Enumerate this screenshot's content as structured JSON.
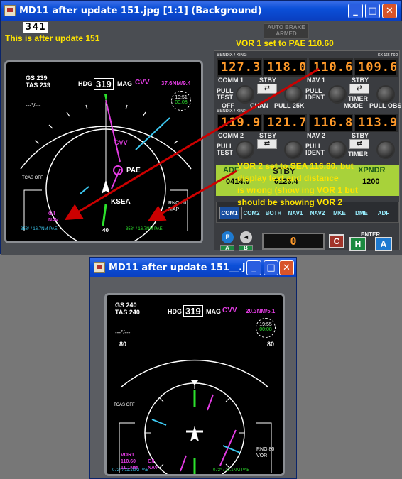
{
  "window1": {
    "title": "MD11 after update 151.jpg [1:1] (Background)",
    "note_top": "This is after update 151",
    "note_vor1": "VOR 1 set to PAE  110.60",
    "note_vor2_l1": "VOR 2 set to SEA  116.80, but",
    "note_vor2_l2": "display text and distance",
    "note_vor2_l3": "is wrong (show ing VOR 1 but",
    "note_vor2_l4": "should be showing VOR 2",
    "counter": "341",
    "autobrake_l1": "AUTO BRAKE",
    "autobrake_l2": "ARMED",
    "nd": {
      "gs": "GS 239",
      "tas": "TAS 239",
      "hdg_label": "HDG",
      "hdg_value": "319",
      "mag_label": "MAG",
      "ref": "CVV",
      "dist": "37.6NM/9.4",
      "clock1": "19:51",
      "clock2": "00:08",
      "wind": "---°/---",
      "tcas": "TCAS OFF",
      "waypoint_cvv": "CVV",
      "waypoint_pae": "PAE",
      "airport": "KSEA",
      "range": "RNG 80",
      "range2": "MAP",
      "mode1": "G/I",
      "mode2": "NAV",
      "range_ring_value": "40",
      "bottom_left": "358° / 16.7NM  PAE",
      "bottom_right": "358° / 16.7NM  PAE"
    },
    "radio": {
      "brand": "BENDIX / KING",
      "model": "KX 165 TSO",
      "comm1_active": "127.30",
      "comm1_stby": "118.00",
      "nav1_active": "110.60",
      "nav1_stby": "109.60",
      "comm2_active": "119.90",
      "comm2_stby": "121.70",
      "nav2_active": "116.80",
      "nav2_stby": "113.90",
      "comm1": "COMM 1",
      "comm2": "COMM 2",
      "nav1": "NAV 1",
      "nav2": "NAV 2",
      "stby": "STBY",
      "pull_test": "PULL TEST",
      "pull_ident": "PULL IDENT",
      "timer": "TIMER",
      "off": "OFF",
      "chan": "CHAN",
      "pull25k": "PULL 25K",
      "mode": "MODE",
      "pull_obs": "PULL OBS",
      "adf": "ADF",
      "xpndr": "XPNDR",
      "adf_freq": "0414.0",
      "stby_freq": "0123.4",
      "xpndr_code": "1200",
      "audio": [
        "COM1",
        "COM2",
        "BOTH",
        "NAV1",
        "NAV2",
        "MKE",
        "DME",
        "ADF"
      ],
      "readout": "0",
      "enter": "ENTER",
      "key_c": "C",
      "key_h": "H",
      "key_a": "A",
      "key_p": "P",
      "key_a2": "A",
      "key_b": "B"
    }
  },
  "window2": {
    "title": "MD11 after update 151__.jpg",
    "nd": {
      "gs": "GS 240",
      "tas": "TAS 240",
      "hdg_label": "HDG",
      "hdg_value": "319",
      "mag_label": "MAG",
      "ref": "CVV",
      "dist": "20.3NM/5.1",
      "clock1": "19:55",
      "clock2": "00:08",
      "wind": "---°/---",
      "range_l": "80",
      "range_r": "80",
      "tcas": "TCAS OFF",
      "vor1_l1": "VOR1",
      "vor1_l2": "110.60",
      "vor1_l3": "11.1NM",
      "mode1": "G/I",
      "mode2": "NAV",
      "range": "RNG 80",
      "range2": "VOR",
      "bottom_left": "072° / 11.1NM  PAE",
      "bottom_right": "072° / 11.1NM  PAE"
    }
  },
  "colors": {
    "accent": "#0b4fd8",
    "annotation": "#ffe400",
    "arrow": "#cc0000"
  }
}
